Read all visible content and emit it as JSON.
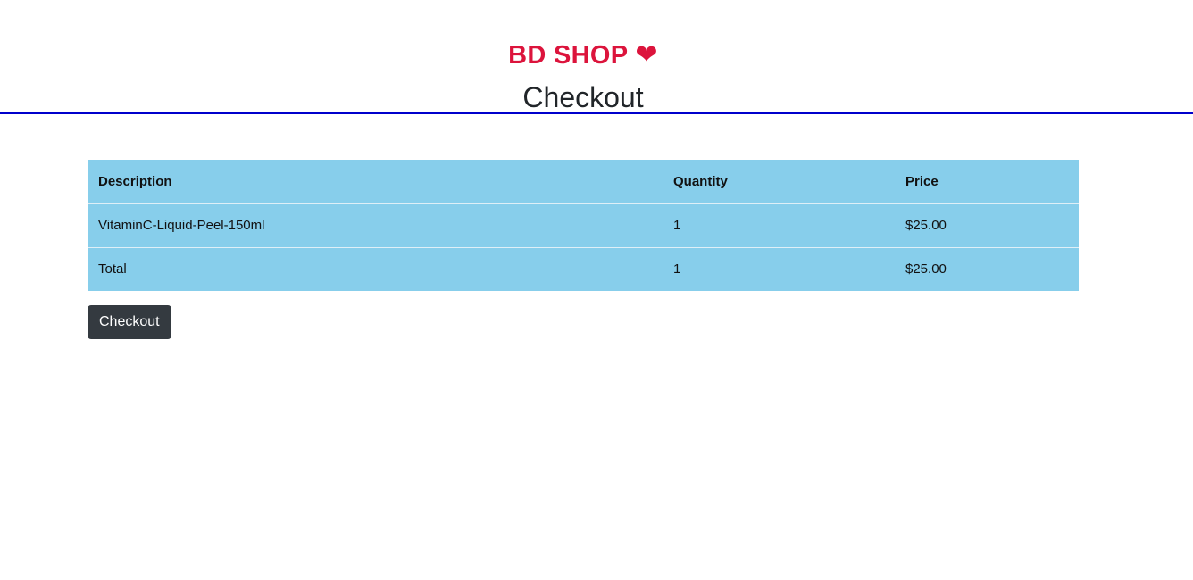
{
  "header": {
    "brand": "BD SHOP",
    "brand_icon": "heart-icon",
    "brand_color": "#dc143c",
    "title": "Checkout",
    "divider_color": "#0000cc"
  },
  "cart_table": {
    "background_color": "#87ceeb",
    "columns": [
      "Description",
      "Quantity",
      "Price"
    ],
    "rows": [
      {
        "description": "VitaminC-Liquid-Peel-150ml",
        "quantity": "1",
        "price": "$25.00"
      }
    ],
    "total": {
      "label": "Total",
      "quantity": "1",
      "price": "$25.00"
    }
  },
  "actions": {
    "checkout_label": "Checkout",
    "button_color": "#343a40"
  }
}
